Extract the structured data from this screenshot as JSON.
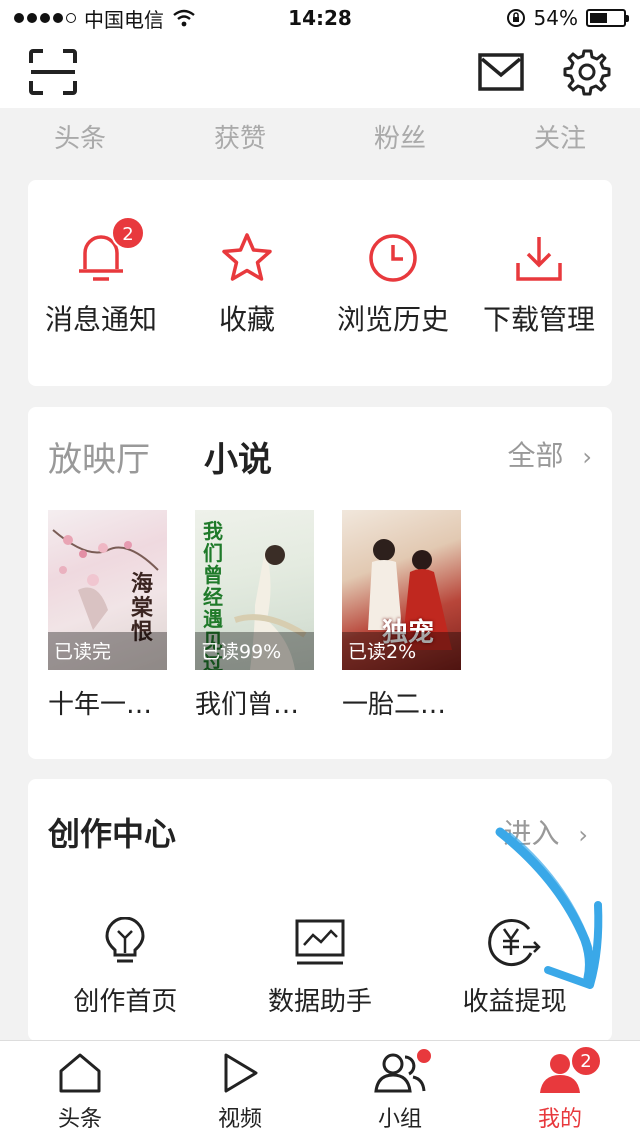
{
  "status_bar": {
    "carrier": "中国电信",
    "time": "14:28",
    "battery": "54%",
    "battery_level": 0.54
  },
  "top_bar": {
    "left_icon": "scan-icon",
    "right_icons": [
      "mail-icon",
      "gear-icon"
    ]
  },
  "stats": [
    "头条",
    "获赞",
    "粉丝",
    "关注"
  ],
  "quick_actions": [
    {
      "label": "消息通知",
      "icon": "bell-icon",
      "badge": "2"
    },
    {
      "label": "收藏",
      "icon": "star-icon"
    },
    {
      "label": "浏览历史",
      "icon": "clock-icon"
    },
    {
      "label": "下载管理",
      "icon": "download-icon"
    }
  ],
  "media": {
    "tabs": [
      "放映厅",
      "小说"
    ],
    "active_tab": "小说",
    "more_label": "全部",
    "books": [
      {
        "title": "十年一…",
        "progress": "已读完",
        "cover_text": "海棠恨"
      },
      {
        "title": "我们曾…",
        "progress": "已读99%",
        "cover_text": "我们曾经遇见过"
      },
      {
        "title": "一胎二…",
        "progress": "已读2%",
        "cover_text": "独宠"
      }
    ]
  },
  "creation": {
    "title": "创作中心",
    "enter_label": "进入",
    "tools": [
      {
        "label": "创作首页",
        "icon": "lightbulb-icon"
      },
      {
        "label": "数据助手",
        "icon": "chart-monitor-icon"
      },
      {
        "label": "收益提现",
        "icon": "yuan-withdraw-icon"
      }
    ]
  },
  "tabbar": {
    "items": [
      {
        "label": "头条",
        "icon": "home-icon"
      },
      {
        "label": "视频",
        "icon": "play-icon"
      },
      {
        "label": "小组",
        "icon": "group-icon",
        "dot": true
      },
      {
        "label": "我的",
        "icon": "user-icon",
        "badge": "2",
        "active": true
      }
    ]
  },
  "colors": {
    "accent": "#e8393d",
    "annotation_arrow": "#3aa8e8"
  }
}
